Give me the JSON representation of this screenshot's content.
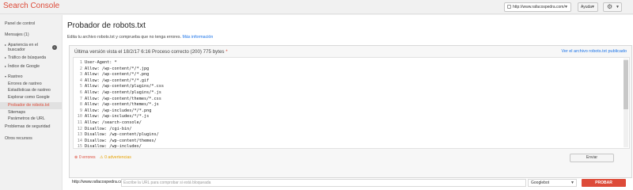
{
  "header": {
    "brand": "Search Console",
    "site": "http://www.rafacospedra.com/",
    "help_label": "Ayuda"
  },
  "sidebar": {
    "items": [
      {
        "label": "Panel de control"
      },
      {
        "label": "Mensajes (1)"
      },
      {
        "label": "Apariencia en el"
      },
      {
        "label": "buscador"
      },
      {
        "label": "Tráfico de búsqueda"
      },
      {
        "label": "Índice de Google"
      },
      {
        "label": "Rastreo"
      },
      {
        "label": "Errores de rastreo"
      },
      {
        "label": "Estadísticas de rastreo"
      },
      {
        "label": "Explorar como Google"
      },
      {
        "label": "Probador de robots.txt"
      },
      {
        "label": "Sitemaps"
      },
      {
        "label": "Parámetros de URL"
      },
      {
        "label": "Problemas de seguridad"
      },
      {
        "label": "Otros recursos"
      }
    ]
  },
  "main": {
    "title": "Probador de robots.txt",
    "intro": "Edita tu archivo robots.txt y comprueba que no tenga errores.",
    "intro_link": "Más información",
    "status": "Última versión vista el 18/2/17 6:16 Proceso correcto (200) 775 bytes",
    "status_marker": "*",
    "view_link": "Ver el archivo robots.txt publicado",
    "code_lines": [
      {
        "n": "1",
        "text": "User-Agent: *"
      },
      {
        "n": "2",
        "text": "Allow: /wp-content/*/*.jpg"
      },
      {
        "n": "3",
        "text": "Allow: /wp-content/*/*.png"
      },
      {
        "n": "4",
        "text": "Allow: /wp-content/*/*.gif"
      },
      {
        "n": "5",
        "text": "Allow: /wp-content/plugins/*.css"
      },
      {
        "n": "6",
        "text": "Allow: /wp-content/plugins/*.js"
      },
      {
        "n": "7",
        "text": "Allow: /wp-content/themes/*.css"
      },
      {
        "n": "8",
        "text": "Allow: /wp-content/themes/*.js"
      },
      {
        "n": "9",
        "text": "Allow: /wp-includes/*/*.png"
      },
      {
        "n": "10",
        "text": "Allow: /wp-includes/*/*.js"
      },
      {
        "n": "11",
        "text": "Allow: /search-console/"
      },
      {
        "n": "12",
        "text": "Disallow: /cgi-bin/"
      },
      {
        "n": "13",
        "text": "Disallow: /wp-content/plugins/"
      },
      {
        "n": "14",
        "text": "Disallow: /wp-content/themes/"
      },
      {
        "n": "15",
        "text": "Disallow: /wp-includes/"
      }
    ],
    "errors": "0 errores",
    "warnings": "0 advertencias",
    "submit_label": "Enviar",
    "url_prefix": "http://www.rafacospedra.com/",
    "url_placeholder": "Escribe la URL para comprobar si está bloqueada",
    "bot": "Googlebot",
    "test_label": "PROBAR"
  },
  "colors": {
    "accent": "#dd4b39",
    "link": "#1a73e8",
    "warning": "#e6a100"
  }
}
